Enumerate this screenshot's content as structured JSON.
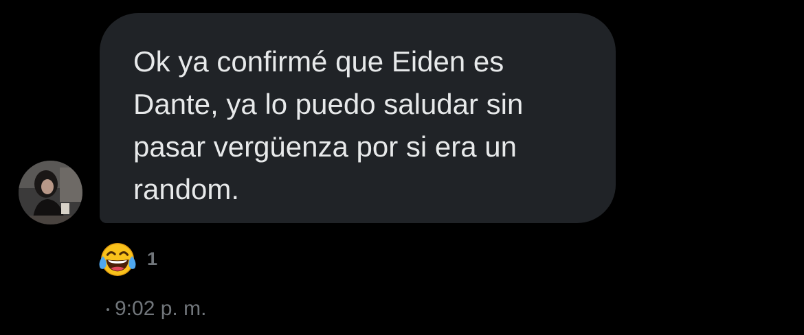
{
  "message": {
    "text": "Ok ya confirmé que Eiden es\nDante, ya lo puedo saludar sin\npasar vergüenza por si era un\nrandom.",
    "reaction": {
      "emoji_icon": "face-with-tears-of-joy-icon",
      "count": "1"
    },
    "timestamp": "9:02 p. m."
  },
  "colors": {
    "background": "#000000",
    "bubble": "#202327",
    "text": "#e7e9ea",
    "secondary_text": "#71767b"
  }
}
